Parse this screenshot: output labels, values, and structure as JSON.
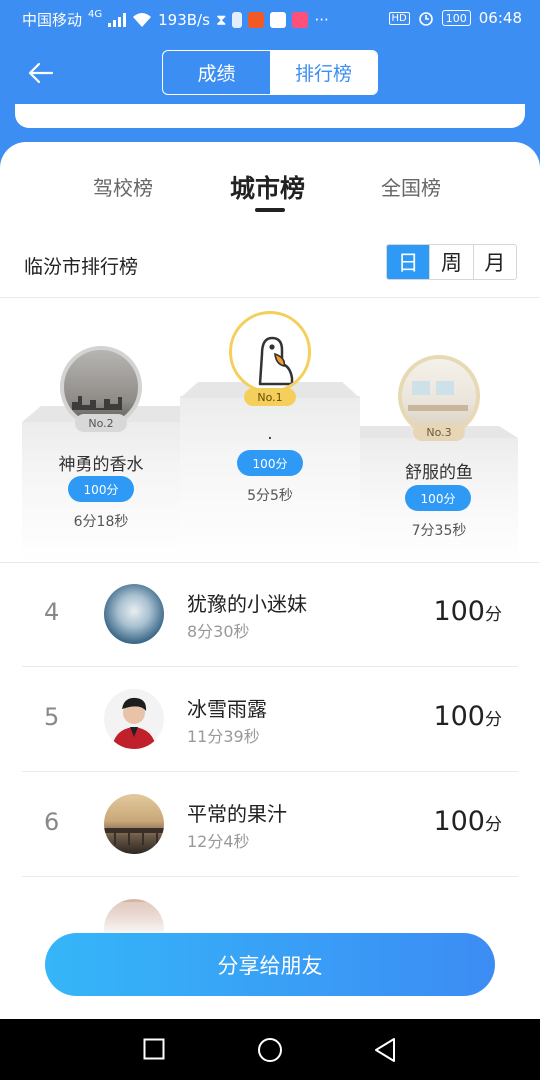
{
  "status_bar": {
    "carrier": "中国移动",
    "network": "4G",
    "speed": "193B/s",
    "more": "···",
    "hd": "HD",
    "battery": "100",
    "time": "06:48"
  },
  "header": {
    "tabs": [
      {
        "label": "成绩",
        "active": true
      },
      {
        "label": "排行榜",
        "active": false
      }
    ]
  },
  "scope_tabs": [
    {
      "label": "驾校榜",
      "active": false
    },
    {
      "label": "城市榜",
      "active": true
    },
    {
      "label": "全国榜",
      "active": false
    }
  ],
  "ranking": {
    "title": "临汾市排行榜",
    "periods": [
      {
        "label": "日",
        "selected": true
      },
      {
        "label": "周",
        "selected": false
      },
      {
        "label": "月",
        "selected": false
      }
    ]
  },
  "podium": {
    "first": {
      "badge": "No.1",
      "name": ".",
      "score": "100分",
      "time": "5分5秒"
    },
    "second": {
      "badge": "No.2",
      "name": "神勇的香水",
      "score": "100分",
      "time": "6分18秒"
    },
    "third": {
      "badge": "No.3",
      "name": "舒服的鱼",
      "score": "100分",
      "time": "7分35秒"
    }
  },
  "list": [
    {
      "rank": "4",
      "name": "犹豫的小迷妹",
      "time": "8分30秒",
      "score": "100",
      "unit": "分"
    },
    {
      "rank": "5",
      "name": "冰雪雨露",
      "time": "11分39秒",
      "score": "100",
      "unit": "分"
    },
    {
      "rank": "6",
      "name": "平常的果汁",
      "time": "12分4秒",
      "score": "100",
      "unit": "分"
    }
  ],
  "share_label": "分享给朋友",
  "colors": {
    "brand_blue": "#3d8ef2",
    "accent": "#2e9af6",
    "gold": "#f5cf5b"
  }
}
